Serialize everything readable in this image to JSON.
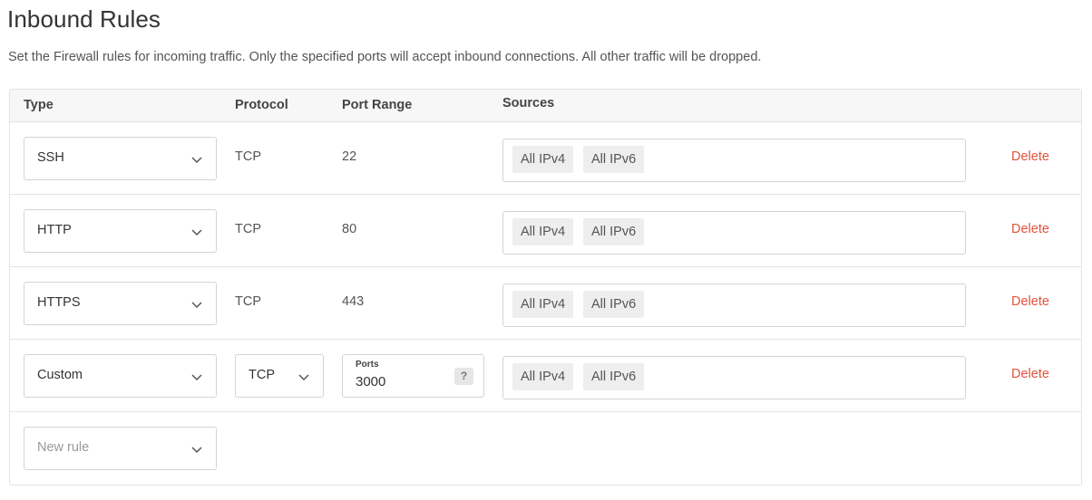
{
  "header": {
    "title": "Inbound Rules",
    "subtitle": "Set the Firewall rules for incoming traffic. Only the specified ports will accept inbound connections. All other traffic will be dropped."
  },
  "table": {
    "columns": {
      "type": "Type",
      "protocol": "Protocol",
      "port_range": "Port Range",
      "sources": "Sources"
    },
    "rows": [
      {
        "type": "SSH",
        "protocol": "TCP",
        "port_range": "22",
        "sources": [
          "All IPv4",
          "All IPv6"
        ],
        "delete_label": "Delete"
      },
      {
        "type": "HTTP",
        "protocol": "TCP",
        "port_range": "80",
        "sources": [
          "All IPv4",
          "All IPv6"
        ],
        "delete_label": "Delete"
      },
      {
        "type": "HTTPS",
        "protocol": "TCP",
        "port_range": "443",
        "sources": [
          "All IPv4",
          "All IPv6"
        ],
        "delete_label": "Delete"
      },
      {
        "type": "Custom",
        "protocol": "TCP",
        "ports_label": "Ports",
        "ports_value": "3000",
        "ports_help": "?",
        "sources": [
          "All IPv4",
          "All IPv6"
        ],
        "delete_label": "Delete"
      }
    ],
    "new_rule": {
      "placeholder": "New rule"
    }
  },
  "colors": {
    "delete": "#e0533c",
    "header_bg": "#f7f7f7",
    "tag_bg": "#eeeeee",
    "border": "#e3e3e3"
  },
  "icons": {
    "dropdown": "chevron-down-icon",
    "help": "question-icon"
  }
}
